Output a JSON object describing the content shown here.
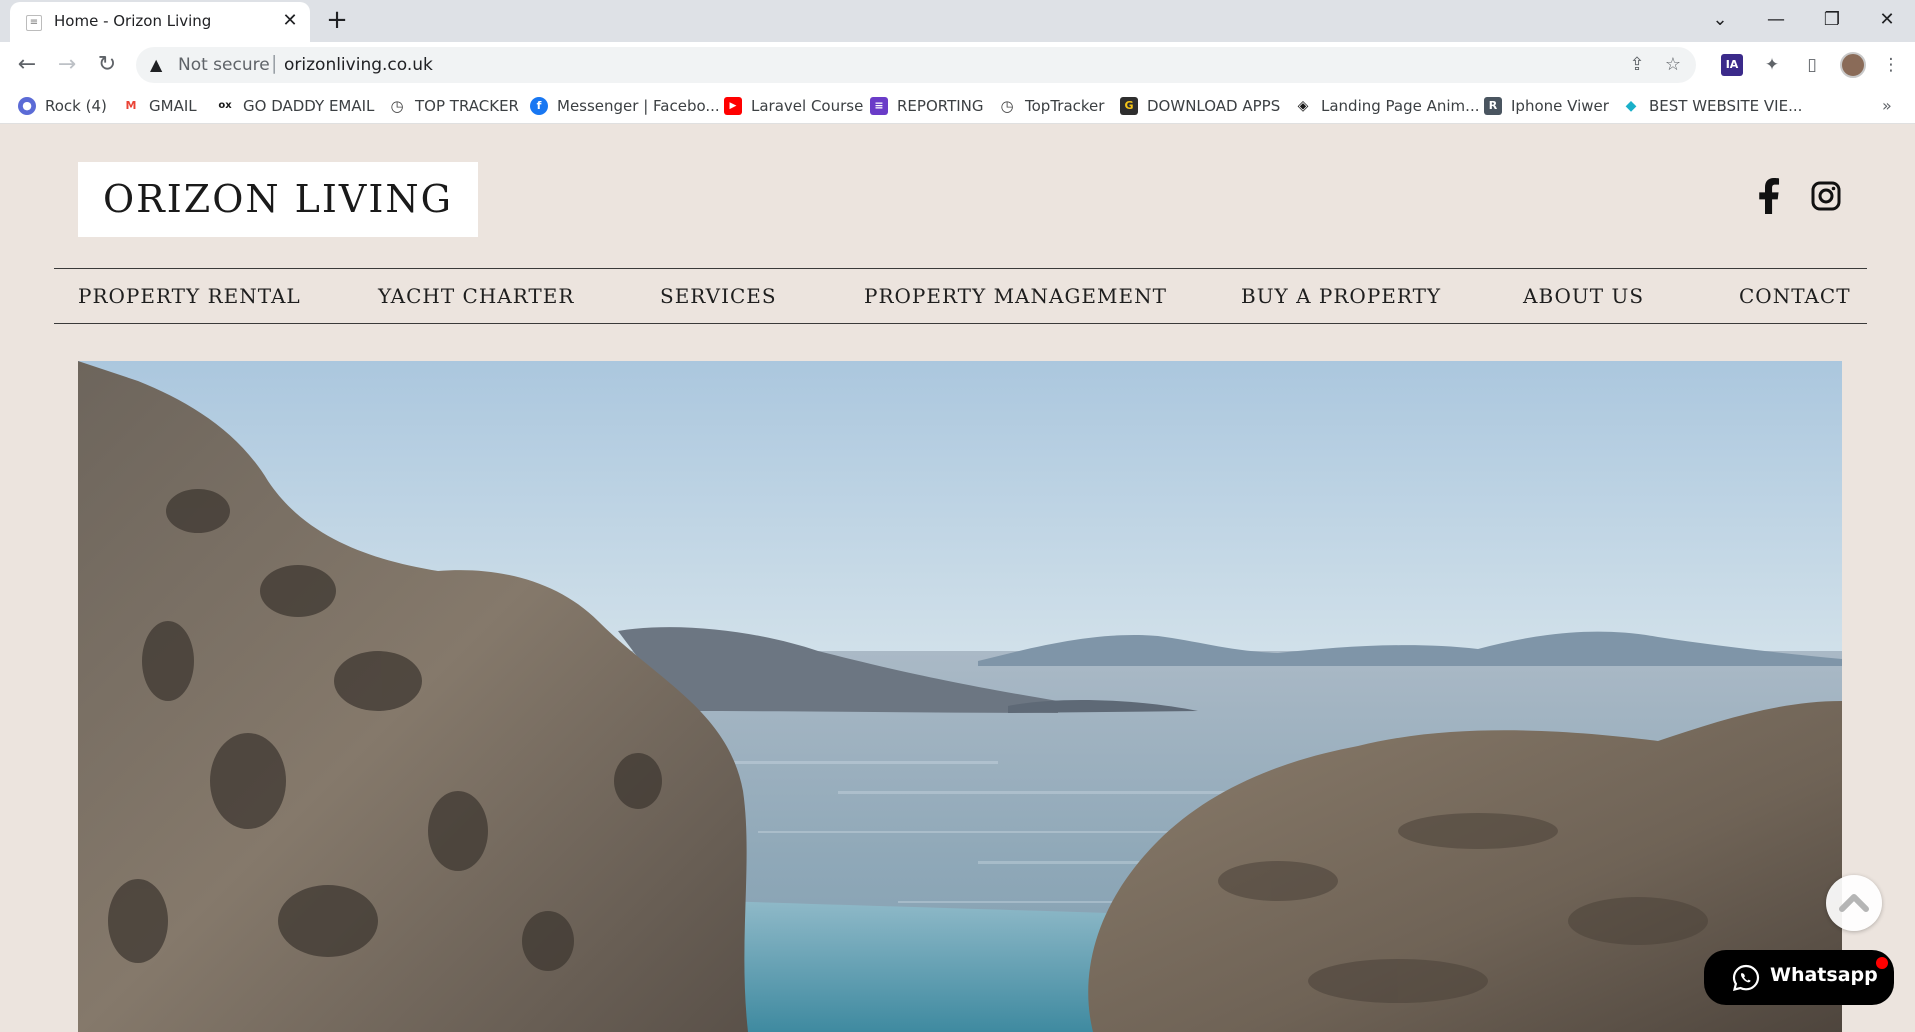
{
  "browser": {
    "tab_title": "Home - Orizon Living",
    "tab_close": "✕",
    "new_tab": "+",
    "window_controls": {
      "dropdown": "⌄",
      "minimize": "—",
      "restore": "❐",
      "close": "✕"
    },
    "nav": {
      "back": "←",
      "forward": "→",
      "reload": "↻"
    },
    "security_icon": "▲",
    "security_label": "Not secure",
    "url_separator": "|",
    "url": "orizonliving.co.uk",
    "omnibox_icons": {
      "share": "⇪",
      "bookmark_star": "☆"
    },
    "extensions": {
      "ia": "IA",
      "puzzle": "✦",
      "side_panel": "▯",
      "menu": "⋮"
    },
    "bookmarks": [
      {
        "label": "Rock (4)",
        "icon": "rock-icon",
        "color": "#5b6bd6",
        "glyph": "●"
      },
      {
        "label": "GMAIL",
        "icon": "gmail-icon",
        "color": "#ea4335",
        "glyph": "M"
      },
      {
        "label": "GO DADDY EMAIL",
        "icon": "godaddy-icon",
        "color": "#1a1a1a",
        "glyph": "ox"
      },
      {
        "label": "TOP TRACKER",
        "icon": "toptracker-icon",
        "color": "#444444",
        "glyph": "◷"
      },
      {
        "label": "Messenger | Facebo...",
        "icon": "facebook-icon",
        "color": "#1877f2",
        "glyph": "f"
      },
      {
        "label": "Laravel Course",
        "icon": "youtube-icon",
        "color": "#ff0000",
        "glyph": "▶"
      },
      {
        "label": "REPORTING",
        "icon": "forms-icon",
        "color": "#6a3cc8",
        "glyph": "≡"
      },
      {
        "label": "TopTracker",
        "icon": "toptracker-icon",
        "color": "#444444",
        "glyph": "◷"
      },
      {
        "label": "DOWNLOAD APPS",
        "icon": "getintopc-icon",
        "color": "#2e2e2e",
        "glyph": "G"
      },
      {
        "label": "Landing Page Anim...",
        "icon": "codepen-icon",
        "color": "#1a1a1a",
        "glyph": "◈"
      },
      {
        "label": "Iphone Viwer",
        "icon": "r-icon",
        "color": "#4a5560",
        "glyph": "R"
      },
      {
        "label": "BEST WEBSITE VIE...",
        "icon": "responsive-icon",
        "color": "#1ab0c9",
        "glyph": "◆"
      }
    ],
    "bookmarks_overflow": "»"
  },
  "site": {
    "logo": "ORIZON LIVING",
    "nav": [
      "PROPERTY RENTAL",
      "YACHT CHARTER",
      "SERVICES",
      "PROPERTY MANAGEMENT",
      "BUY A PROPERTY",
      "ABOUT US",
      "CONTACT"
    ],
    "social": [
      "facebook-icon",
      "instagram-icon"
    ],
    "whatsapp_label": "Whatsapp",
    "colors": {
      "page_bg": "#ece4de",
      "text": "#1e1e1e",
      "whatsapp_bg": "#000000",
      "notification_dot": "#ff0000"
    }
  }
}
